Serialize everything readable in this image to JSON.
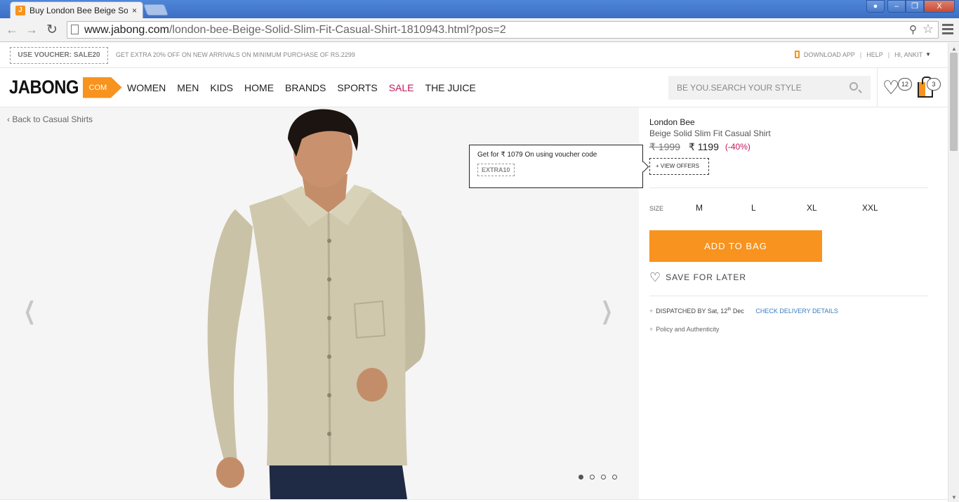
{
  "browser": {
    "tab_title": "Buy London Bee Beige Sol",
    "tab_favicon": "J",
    "tab_close": "×",
    "url_domain": "www.jabong.com",
    "url_path": "/london-bee-Beige-Solid-Slim-Fit-Casual-Shirt-1810943.html?pos=2",
    "window_minimize": "–",
    "window_maximize": "❐",
    "window_close": "X"
  },
  "promo": {
    "voucher": "USE VOUCHER: SALE20",
    "text": "GET EXTRA 20% OFF ON NEW ARRIVALS ON MINIMUM PURCHASE OF RS.2299",
    "download_app": "DOWNLOAD APP",
    "help": "HELP",
    "greeting": "HI, ANKIT"
  },
  "header": {
    "logo_word": "JABONG",
    "logo_com": "COM",
    "nav": [
      "WOMEN",
      "MEN",
      "KIDS",
      "HOME",
      "BRANDS",
      "SPORTS",
      "SALE",
      "THE JUICE"
    ],
    "search_placeholder": "BE YOU.SEARCH YOUR STYLE",
    "wishlist_count": "12",
    "bag_count": "3"
  },
  "gallery": {
    "back_link": "Back to Casual Shirts",
    "image_count": 4,
    "active_index": 0
  },
  "offer_popup": {
    "text": "Get for ₹ 1079 On using voucher code",
    "code": "EXTRA10"
  },
  "product": {
    "brand": "London Bee",
    "name": "Beige Solid Slim Fit Casual Shirt",
    "old_price": "₹ 1999",
    "new_price": "₹ 1199",
    "discount": "(-40%)",
    "view_offers": "+ VIEW OFFERS",
    "size_label": "SIZE",
    "sizes": [
      "M",
      "L",
      "XL",
      "XXL"
    ],
    "add_to_bag": "ADD TO BAG",
    "save_for_later": "SAVE FOR LATER",
    "dispatched_prefix": "DISPATCHED BY Sat, 12",
    "dispatched_sup": "th",
    "dispatched_suffix": " Dec",
    "check_delivery": "CHECK DELIVERY DETAILS",
    "policy": "Policy and Authenticity"
  },
  "colors": {
    "accent": "#f7931e",
    "sale": "#c2185b",
    "link": "#3a7bbf"
  }
}
